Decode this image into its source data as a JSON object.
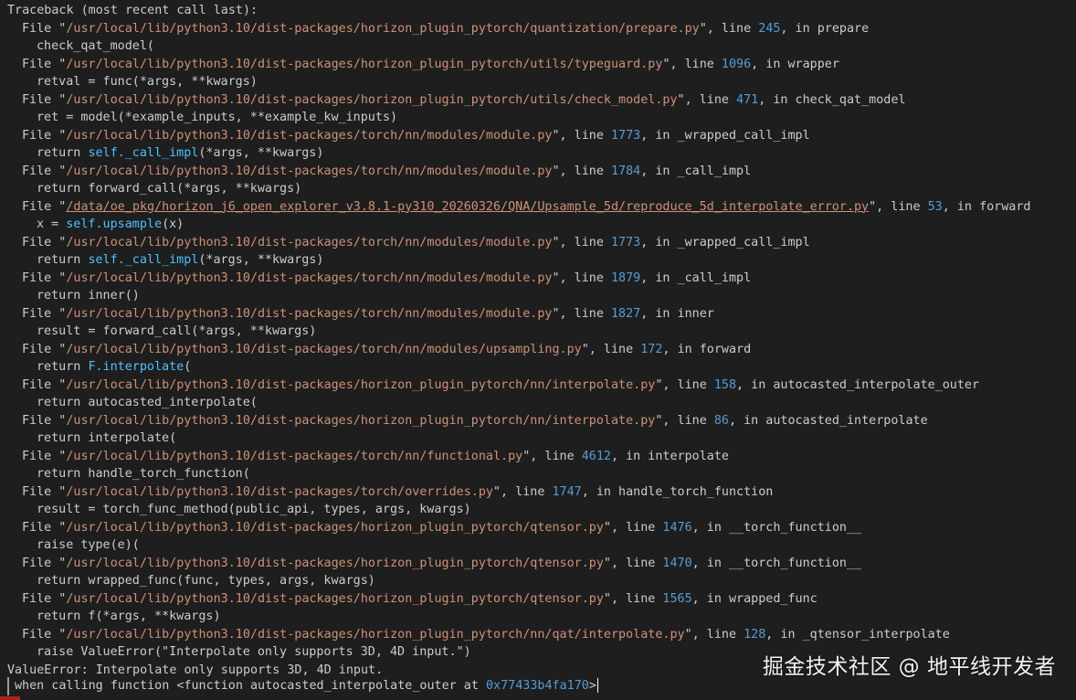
{
  "terminal": {
    "header": "Traceback (most recent call last):",
    "frames": [
      {
        "path": "/usr/local/lib/python3.10/dist-packages/horizon_plugin_pytorch/quantization/prepare.py",
        "line": "245",
        "func": "prepare",
        "code": "check_qat_model("
      },
      {
        "path": "/usr/local/lib/python3.10/dist-packages/horizon_plugin_pytorch/utils/typeguard.py",
        "line": "1096",
        "func": "wrapper",
        "code": "retval = func(*args, **kwargs)"
      },
      {
        "path": "/usr/local/lib/python3.10/dist-packages/horizon_plugin_pytorch/utils/check_model.py",
        "line": "471",
        "func": "check_qat_model",
        "code": "ret = model(*example_inputs, **example_kw_inputs)"
      },
      {
        "path": "/usr/local/lib/python3.10/dist-packages/torch/nn/modules/module.py",
        "line": "1773",
        "func": "_wrapped_call_impl",
        "code_pre": "return ",
        "code_sym": "self._call_impl",
        "code_post": "(*args, **kwargs)"
      },
      {
        "path": "/usr/local/lib/python3.10/dist-packages/torch/nn/modules/module.py",
        "line": "1784",
        "func": "_call_impl",
        "code": "return forward_call(*args, **kwargs)"
      },
      {
        "path": "/data/oe_pkg/horizon_j6_open_explorer_v3.8.1-py310_20260326/QNA/Upsample_5d/reproduce_5d_interpolate_error.py",
        "line": "53",
        "func": "forward",
        "link": true,
        "code_pre": "x = ",
        "code_sym": "self.upsample",
        "code_post": "(x)"
      },
      {
        "path": "/usr/local/lib/python3.10/dist-packages/torch/nn/modules/module.py",
        "line": "1773",
        "func": "_wrapped_call_impl",
        "code_pre": "return ",
        "code_sym": "self._call_impl",
        "code_post": "(*args, **kwargs)"
      },
      {
        "path": "/usr/local/lib/python3.10/dist-packages/torch/nn/modules/module.py",
        "line": "1879",
        "func": "_call_impl",
        "code": "return inner()"
      },
      {
        "path": "/usr/local/lib/python3.10/dist-packages/torch/nn/modules/module.py",
        "line": "1827",
        "func": "inner",
        "code": "result = forward_call(*args, **kwargs)"
      },
      {
        "path": "/usr/local/lib/python3.10/dist-packages/torch/nn/modules/upsampling.py",
        "line": "172",
        "func": "forward",
        "code_pre": "return ",
        "code_sym": "F.interpolate",
        "code_post": "("
      },
      {
        "path": "/usr/local/lib/python3.10/dist-packages/horizon_plugin_pytorch/nn/interpolate.py",
        "line": "158",
        "func": "autocasted_interpolate_outer",
        "code": "return autocasted_interpolate("
      },
      {
        "path": "/usr/local/lib/python3.10/dist-packages/horizon_plugin_pytorch/nn/interpolate.py",
        "line": "86",
        "func": "autocasted_interpolate",
        "code": "return interpolate("
      },
      {
        "path": "/usr/local/lib/python3.10/dist-packages/torch/nn/functional.py",
        "line": "4612",
        "func": "interpolate",
        "code": "return handle_torch_function("
      },
      {
        "path": "/usr/local/lib/python3.10/dist-packages/torch/overrides.py",
        "line": "1747",
        "func": "handle_torch_function",
        "code": "result = torch_func_method(public_api, types, args, kwargs)"
      },
      {
        "path": "/usr/local/lib/python3.10/dist-packages/horizon_plugin_pytorch/qtensor.py",
        "line": "1476",
        "func": "__torch_function__",
        "code": "raise type(e)("
      },
      {
        "path": "/usr/local/lib/python3.10/dist-packages/horizon_plugin_pytorch/qtensor.py",
        "line": "1470",
        "func": "__torch_function__",
        "code": "return wrapped_func(func, types, args, kwargs)"
      },
      {
        "path": "/usr/local/lib/python3.10/dist-packages/horizon_plugin_pytorch/qtensor.py",
        "line": "1565",
        "func": "wrapped_func",
        "code": "return f(*args, **kwargs)"
      },
      {
        "path": "/usr/local/lib/python3.10/dist-packages/horizon_plugin_pytorch/nn/qat/interpolate.py",
        "line": "128",
        "func": "_qtensor_interpolate",
        "code": "raise ValueError(\"Interpolate only supports 3D, 4D input.\")"
      }
    ],
    "error": "ValueError: Interpolate only supports 3D, 4D input.",
    "tail_pre": "when calling function <function autocasted_interpolate_outer at ",
    "tail_addr": "0x77433b4fa170",
    "tail_post": ">"
  },
  "watermark": "掘金技术社区 @ 地平线开发者",
  "colors": {
    "background": "#1e1e1e",
    "text": "#cccccc",
    "path": "#ce9178",
    "number": "#569cd6",
    "symbol": "#4fc1ff"
  }
}
